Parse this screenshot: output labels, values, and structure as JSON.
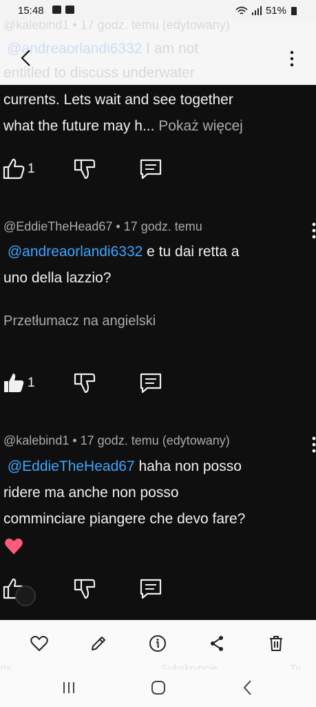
{
  "status_bar": {
    "time": "15:48",
    "battery": "51%"
  },
  "top_overlay": {
    "meta": "@kalebind1 • 17 godz. temu (edytowany)",
    "mention": "@andreaorlandi6332",
    "line1_rest": " I am not",
    "line2": "entitled to discuss underwater"
  },
  "comment1": {
    "line1": "currents. Lets wait and see together",
    "line2": "what the future may h...",
    "more": " Pokaż więcej",
    "likes": "1"
  },
  "comment2": {
    "meta": "@EddieTheHead67 • 17 godz. temu",
    "mention": "@andreaorlandi6332",
    "line1_rest": " e tu dai retta a",
    "line2": "uno della lazzio?",
    "translate": "Przetłumacz na angielski",
    "likes": "1"
  },
  "comment3": {
    "meta": "@kalebind1 • 17 godz. temu (edytowany)",
    "mention": "@EddieTheHead67",
    "line1_rest": " haha non posso",
    "line2": "ridere ma anche non posso",
    "line3": "comminciare piangere che devo fare?"
  },
  "bottom_ghost": {
    "left": "rts",
    "center": "Subskrypcje",
    "right": "Ty"
  },
  "icons": [
    "back-icon",
    "more-vert-icon",
    "thumbs-up-icon",
    "thumbs-down-icon",
    "reply-icon",
    "heart-icon",
    "edit-icon",
    "info-icon",
    "share-icon",
    "trash-icon",
    "recent-apps-icon",
    "home-icon",
    "nav-back-icon"
  ]
}
